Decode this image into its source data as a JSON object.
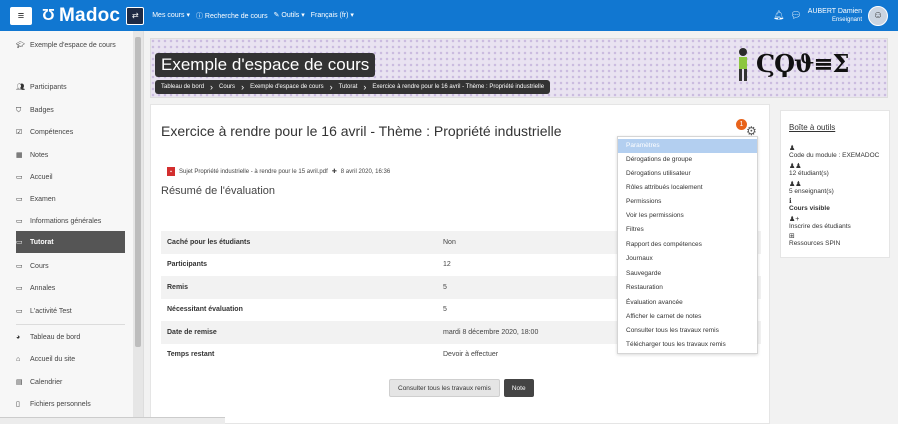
{
  "navbar": {
    "logo": "Madoc",
    "links": [
      "Mes cours ▾",
      "Recherche de cours",
      "Outils ▾",
      "Français (fr) ▾"
    ],
    "user_name": "AUBERT Damien",
    "user_role": "Enseignant",
    "color": "#1177d1"
  },
  "sidebar": {
    "items": [
      "Exemple d'espace de cours",
      "Participants",
      "Badges",
      "Compétences",
      "Notes",
      "Accueil",
      "Examen",
      "Informations générales",
      "Tutorat",
      "Cours",
      "Annales",
      "L'activité Test",
      "Tableau de bord",
      "Accueil du site",
      "Calendrier",
      "Fichiers personnels"
    ],
    "active": "Tutorat"
  },
  "banner": {
    "course_title": "Exemple d'espace de cours",
    "breadcrumb": [
      "Tableau de bord",
      "Cours",
      "Exemple d'espace de cours",
      "Tutorat",
      "Exercice à rendre pour le 16 avril - Thème : Propriété industrielle"
    ]
  },
  "main": {
    "title": "Exercice à rendre pour le 16 avril - Thème : Propriété industrielle",
    "notification_count": "1",
    "attachment_name": "Sujet Propriété industrielle - à rendre pour le 15 avril.pdf",
    "attachment_date": "8 avril 2020, 16:36",
    "summary_title": "Résumé de l'évaluation",
    "table": [
      {
        "label": "Caché pour les étudiants",
        "value": "Non"
      },
      {
        "label": "Participants",
        "value": "12"
      },
      {
        "label": "Remis",
        "value": "5"
      },
      {
        "label": "Nécessitant évaluation",
        "value": "5"
      },
      {
        "label": "Date de remise",
        "value": "mardi 8 décembre 2020, 18:00"
      },
      {
        "label": "Temps restant",
        "value": "Devoir à effectuer"
      }
    ],
    "button_view": "Consulter tous les travaux remis",
    "button_grade": "Note"
  },
  "menu": {
    "items": [
      "Paramètres",
      "Dérogations de groupe",
      "Dérogations utilisateur",
      "Rôles attribués localement",
      "Permissions",
      "Voir les permissions",
      "Filtres",
      "Rapport des compétences",
      "Journaux",
      "Sauvegarde",
      "Restauration",
      "Évaluation avancée",
      "Afficher le carnet de notes",
      "Consulter tous les travaux remis",
      "Télécharger tous les travaux remis"
    ],
    "highlighted": "Paramètres"
  },
  "tools": {
    "title": "Boîte à outils",
    "module_code": "Code du module : EXEMADOC",
    "students": "12 étudiant(s)",
    "teachers": "5 enseignant(s)",
    "visibility": "Cours visible",
    "enroll": "Inscrire des étudiants",
    "resources": "Ressources SPIN"
  }
}
